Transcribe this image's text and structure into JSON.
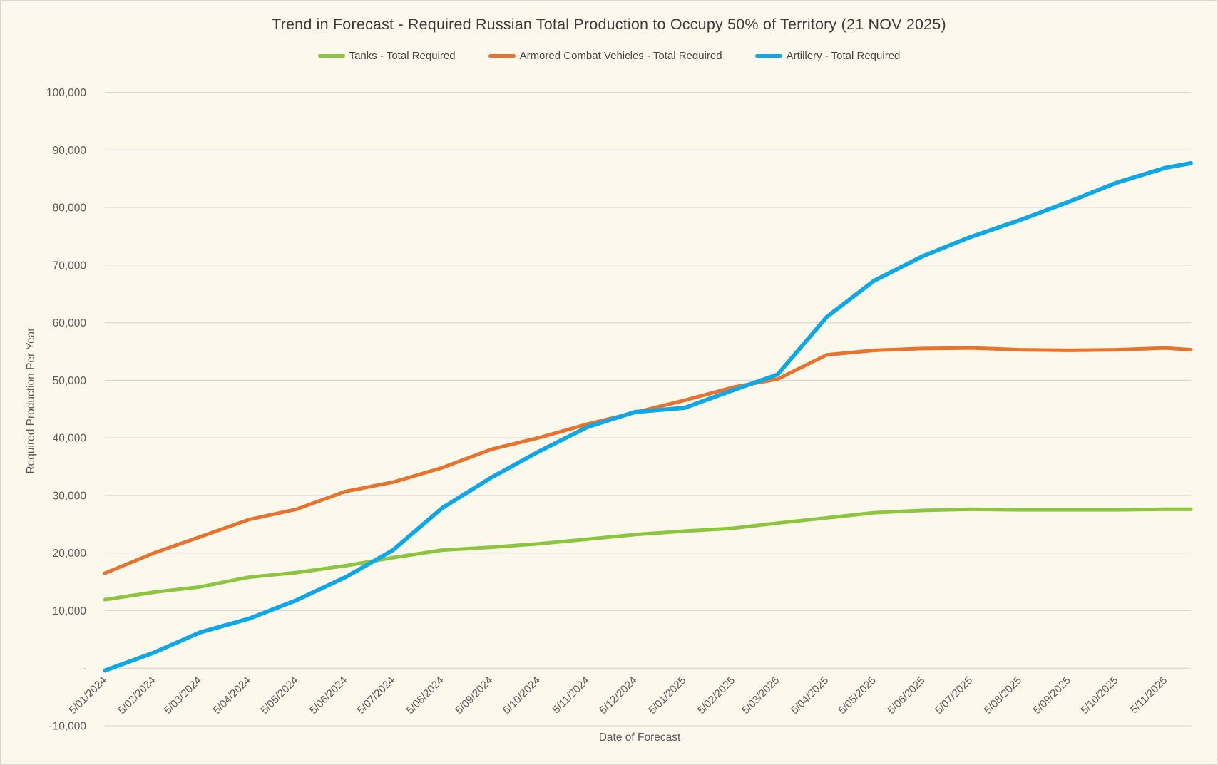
{
  "window": {
    "background_color": "#fdf8ec",
    "border_color": "#d8d6ce",
    "gridline_color": "#d9d9d9",
    "axis_text_color": "#595959",
    "title_text_color": "#3b3b3b"
  },
  "chart_data": {
    "type": "line",
    "title": "Trend in Forecast - Required Russian Total Production to Occupy 50% of Territory (21 NOV 2025)",
    "xlabel": "Date of Forecast",
    "ylabel": "Required Production Per Year",
    "ylim": [
      -10000,
      100000
    ],
    "ytick_step": 10000,
    "grid": "horizontal",
    "legend_position": "top",
    "y_ticks": [
      {
        "value": 100000,
        "label": "100,000"
      },
      {
        "value": 90000,
        "label": "90,000"
      },
      {
        "value": 80000,
        "label": "80,000"
      },
      {
        "value": 70000,
        "label": "70,000"
      },
      {
        "value": 60000,
        "label": "60,000"
      },
      {
        "value": 50000,
        "label": "50,000"
      },
      {
        "value": 40000,
        "label": "40,000"
      },
      {
        "value": 30000,
        "label": "30,000"
      },
      {
        "value": 20000,
        "label": "20,000"
      },
      {
        "value": 10000,
        "label": "10,000"
      },
      {
        "value": 0,
        "label": "-"
      },
      {
        "value": -10000,
        "label": "-10,000"
      }
    ],
    "x_tick_labels": [
      "5/01/2024",
      "5/02/2024",
      "5/03/2024",
      "5/04/2024",
      "5/05/2024",
      "5/06/2024",
      "5/07/2024",
      "5/08/2024",
      "5/09/2024",
      "5/10/2024",
      "5/11/2024",
      "5/12/2024",
      "5/01/2025",
      "5/02/2025",
      "5/03/2025",
      "5/04/2025",
      "5/05/2025",
      "5/06/2025",
      "5/07/2025",
      "5/08/2025",
      "5/09/2025",
      "5/10/2025",
      "5/11/2025"
    ],
    "x_days": [
      0,
      31,
      60,
      91,
      121,
      152,
      182,
      213,
      244,
      274,
      305,
      335,
      366,
      397,
      425,
      456,
      486,
      517,
      547,
      578,
      609,
      639,
      670,
      686
    ],
    "x_point_dates": [
      "5/01/2024",
      "5/02/2024",
      "5/03/2024",
      "5/04/2024",
      "5/05/2024",
      "5/06/2024",
      "5/07/2024",
      "5/08/2024",
      "5/09/2024",
      "5/10/2024",
      "5/11/2024",
      "5/12/2024",
      "5/01/2025",
      "5/02/2025",
      "5/03/2025",
      "5/04/2025",
      "5/05/2025",
      "5/06/2025",
      "5/07/2025",
      "5/08/2025",
      "5/09/2025",
      "5/10/2025",
      "5/11/2025",
      "21/11/2025"
    ],
    "series": [
      {
        "name": "Tanks - Total Required",
        "color": "#8CC63F",
        "values": [
          11900,
          13200,
          14100,
          15800,
          16600,
          17800,
          19200,
          20500,
          21000,
          21600,
          22400,
          23200,
          23800,
          24300,
          25200,
          26100,
          27000,
          27400,
          27600,
          27500,
          27500,
          27500,
          27600,
          27600
        ]
      },
      {
        "name": "Armored Combat Vehicles - Total Required",
        "color": "#E8732C",
        "values": [
          16500,
          20000,
          22800,
          25800,
          27600,
          30700,
          32300,
          34800,
          38000,
          40000,
          42400,
          44400,
          46500,
          48800,
          50200,
          54400,
          55200,
          55500,
          55600,
          55300,
          55200,
          55300,
          55600,
          55300
        ]
      },
      {
        "name": "Artillery - Total Required",
        "color": "#0FA8E6",
        "values": [
          -400,
          2700,
          6200,
          8600,
          11800,
          15800,
          20500,
          27800,
          33100,
          37600,
          41900,
          44500,
          45200,
          48300,
          51000,
          61000,
          67300,
          71600,
          74900,
          77800,
          81000,
          84300,
          86900,
          87700
        ]
      }
    ]
  }
}
